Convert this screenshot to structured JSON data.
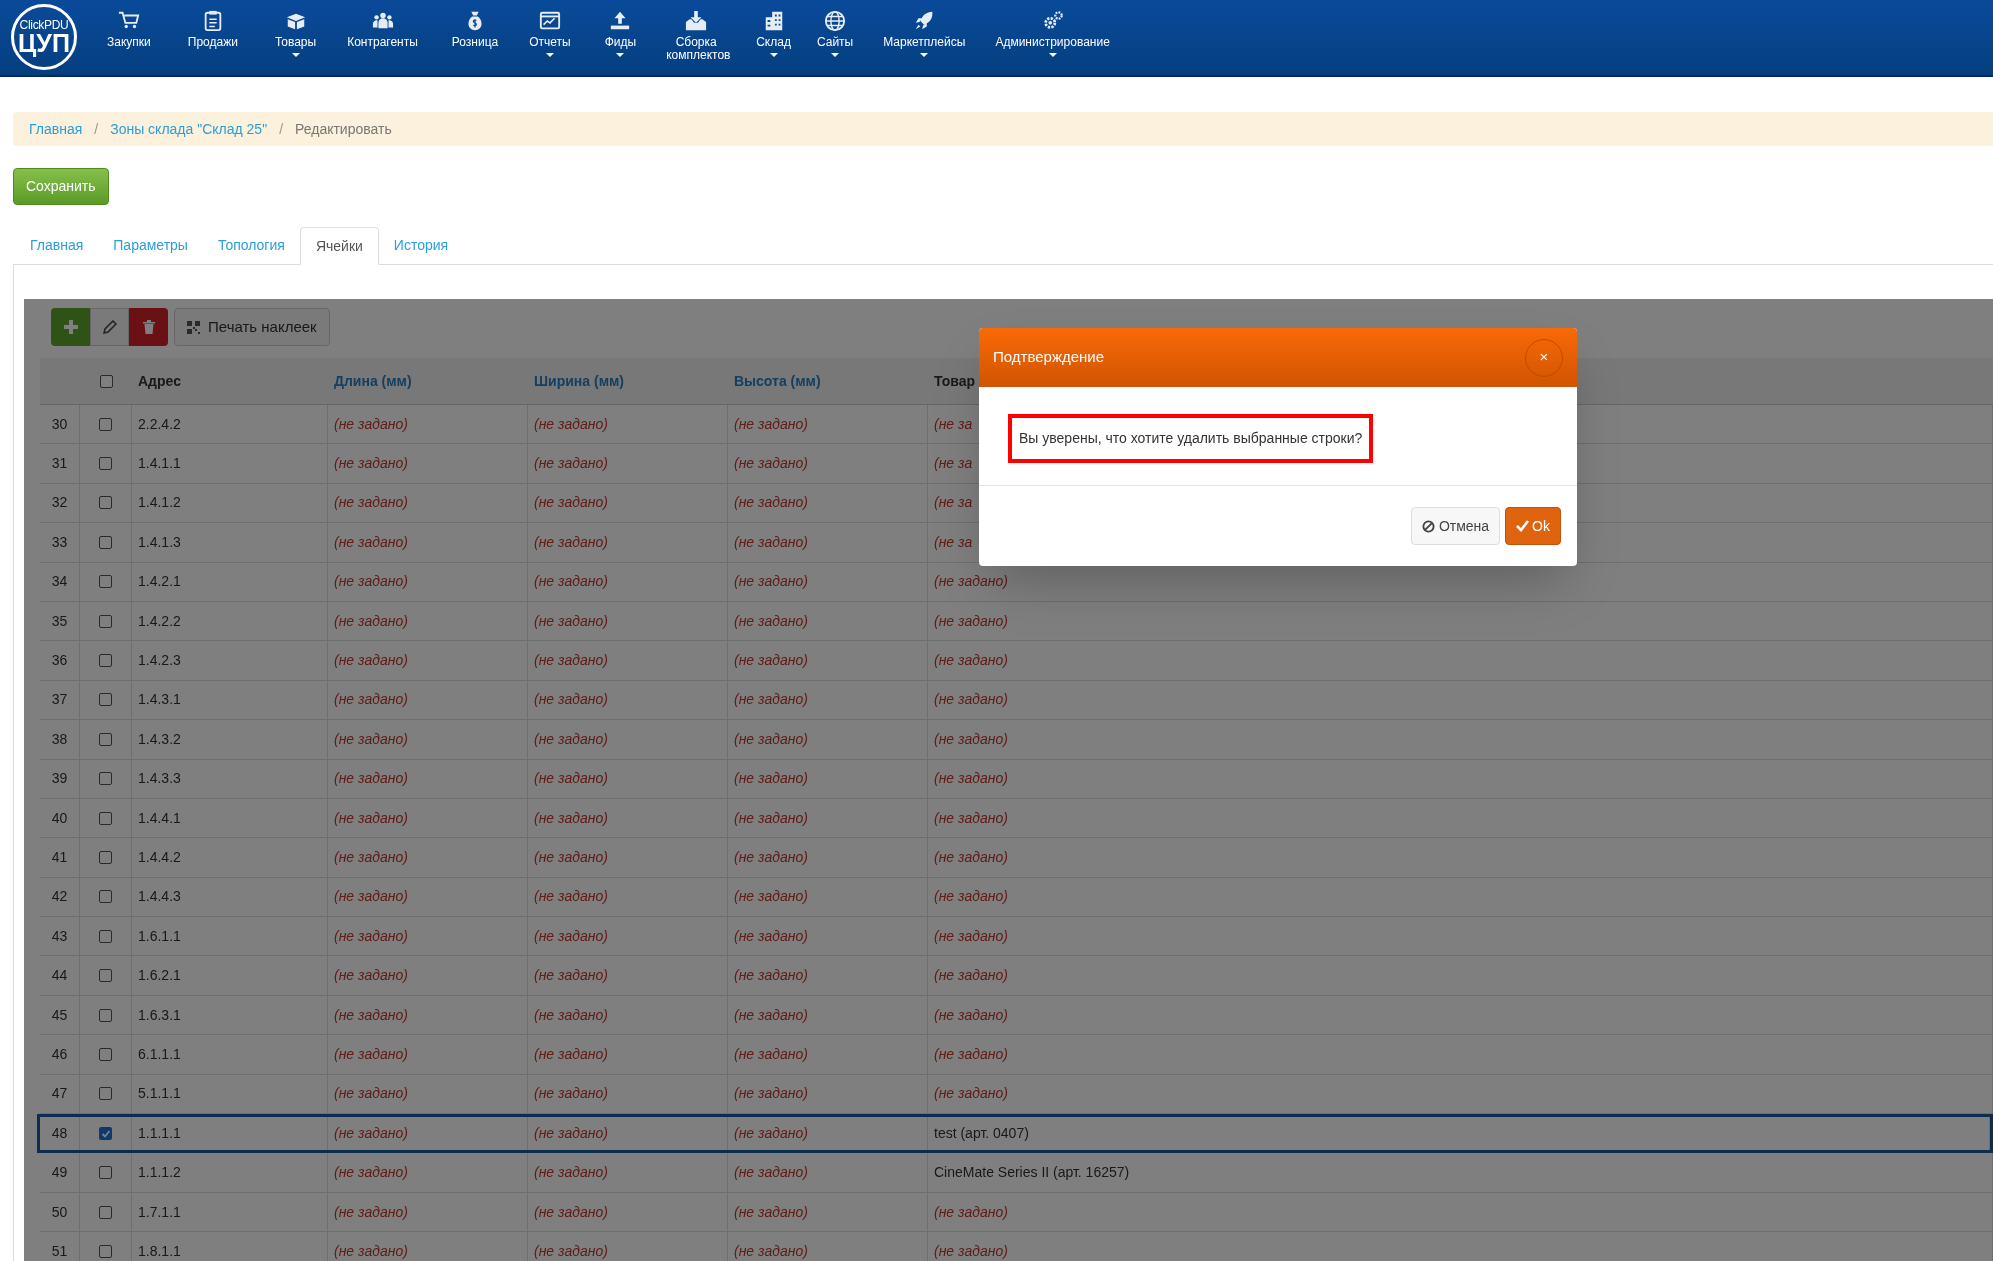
{
  "logo": {
    "line_1": "ClickPDU",
    "line_2": "ЦУП"
  },
  "nav": [
    {
      "label": "Закупки",
      "dropdown": false
    },
    {
      "label": "Продажи",
      "dropdown": false
    },
    {
      "label": "Товары",
      "dropdown": true
    },
    {
      "label": "Контрагенты",
      "dropdown": false
    },
    {
      "label": "Розница",
      "dropdown": false
    },
    {
      "label": "Отчеты",
      "dropdown": true
    },
    {
      "label": "Фиды",
      "dropdown": true
    },
    {
      "label": "Сборка комплектов",
      "dropdown": false
    },
    {
      "label": "Склад",
      "dropdown": true
    },
    {
      "label": "Сайты",
      "dropdown": true
    },
    {
      "label": "Маркетплейсы",
      "dropdown": true
    },
    {
      "label": "Администрирование",
      "dropdown": true
    }
  ],
  "breadcrumb": [
    {
      "label": "Главная",
      "current": false
    },
    {
      "separator": "/",
      "label": "Зоны склада \"Склад 25\"",
      "current": false
    },
    {
      "separator": "/",
      "label": "Редактировать",
      "current": true
    }
  ],
  "save_button": "Сохранить",
  "tabs": [
    {
      "label": "Главная",
      "selected": false
    },
    {
      "label": "Параметры",
      "selected": false
    },
    {
      "label": "Топология",
      "selected": false
    },
    {
      "label": "Ячейки",
      "selected": true
    },
    {
      "label": "История",
      "selected": false
    }
  ],
  "toolbar": {
    "print_button": "Печать наклеек"
  },
  "table": {
    "columns": [
      {
        "label": "Адрес",
        "sortable": false
      },
      {
        "label": "Длина (мм)",
        "sortable": true
      },
      {
        "label": "Ширина (мм)",
        "sortable": true
      },
      {
        "label": "Высота (мм)",
        "sortable": true
      },
      {
        "label": "Товар",
        "sortable": false
      }
    ],
    "header_checked": false,
    "rows": [
      {
        "number": "30",
        "checked": false,
        "cells": [
          {
            "text": "2.2.4.2",
            "unset": false
          },
          {
            "text": "(не задано)",
            "unset": true
          },
          {
            "text": "(не задано)",
            "unset": true
          },
          {
            "text": "(не задано)",
            "unset": true
          },
          {
            "text": "(не за",
            "unset": true
          }
        ]
      },
      {
        "number": "31",
        "checked": false,
        "cells": [
          {
            "text": "1.4.1.1",
            "unset": false
          },
          {
            "text": "(не задано)",
            "unset": true
          },
          {
            "text": "(не задано)",
            "unset": true
          },
          {
            "text": "(не задано)",
            "unset": true
          },
          {
            "text": "(не за",
            "unset": true
          }
        ]
      },
      {
        "number": "32",
        "checked": false,
        "cells": [
          {
            "text": "1.4.1.2",
            "unset": false
          },
          {
            "text": "(не задано)",
            "unset": true
          },
          {
            "text": "(не задано)",
            "unset": true
          },
          {
            "text": "(не задано)",
            "unset": true
          },
          {
            "text": "(не за",
            "unset": true
          }
        ]
      },
      {
        "number": "33",
        "checked": false,
        "cells": [
          {
            "text": "1.4.1.3",
            "unset": false
          },
          {
            "text": "(не задано)",
            "unset": true
          },
          {
            "text": "(не задано)",
            "unset": true
          },
          {
            "text": "(не задано)",
            "unset": true
          },
          {
            "text": "(не за",
            "unset": true
          }
        ]
      },
      {
        "number": "34",
        "checked": false,
        "cells": [
          {
            "text": "1.4.2.1",
            "unset": false
          },
          {
            "text": "(не задано)",
            "unset": true
          },
          {
            "text": "(не задано)",
            "unset": true
          },
          {
            "text": "(не задано)",
            "unset": true
          },
          {
            "text": "(не задано)",
            "unset": true
          }
        ]
      },
      {
        "number": "35",
        "checked": false,
        "cells": [
          {
            "text": "1.4.2.2",
            "unset": false
          },
          {
            "text": "(не задано)",
            "unset": true
          },
          {
            "text": "(не задано)",
            "unset": true
          },
          {
            "text": "(не задано)",
            "unset": true
          },
          {
            "text": "(не задано)",
            "unset": true
          }
        ]
      },
      {
        "number": "36",
        "checked": false,
        "cells": [
          {
            "text": "1.4.2.3",
            "unset": false
          },
          {
            "text": "(не задано)",
            "unset": true
          },
          {
            "text": "(не задано)",
            "unset": true
          },
          {
            "text": "(не задано)",
            "unset": true
          },
          {
            "text": "(не задано)",
            "unset": true
          }
        ]
      },
      {
        "number": "37",
        "checked": false,
        "cells": [
          {
            "text": "1.4.3.1",
            "unset": false
          },
          {
            "text": "(не задано)",
            "unset": true
          },
          {
            "text": "(не задано)",
            "unset": true
          },
          {
            "text": "(не задано)",
            "unset": true
          },
          {
            "text": "(не задано)",
            "unset": true
          }
        ]
      },
      {
        "number": "38",
        "checked": false,
        "cells": [
          {
            "text": "1.4.3.2",
            "unset": false
          },
          {
            "text": "(не задано)",
            "unset": true
          },
          {
            "text": "(не задано)",
            "unset": true
          },
          {
            "text": "(не задано)",
            "unset": true
          },
          {
            "text": "(не задано)",
            "unset": true
          }
        ]
      },
      {
        "number": "39",
        "checked": false,
        "cells": [
          {
            "text": "1.4.3.3",
            "unset": false
          },
          {
            "text": "(не задано)",
            "unset": true
          },
          {
            "text": "(не задано)",
            "unset": true
          },
          {
            "text": "(не задано)",
            "unset": true
          },
          {
            "text": "(не задано)",
            "unset": true
          }
        ]
      },
      {
        "number": "40",
        "checked": false,
        "cells": [
          {
            "text": "1.4.4.1",
            "unset": false
          },
          {
            "text": "(не задано)",
            "unset": true
          },
          {
            "text": "(не задано)",
            "unset": true
          },
          {
            "text": "(не задано)",
            "unset": true
          },
          {
            "text": "(не задано)",
            "unset": true
          }
        ]
      },
      {
        "number": "41",
        "checked": false,
        "cells": [
          {
            "text": "1.4.4.2",
            "unset": false
          },
          {
            "text": "(не задано)",
            "unset": true
          },
          {
            "text": "(не задано)",
            "unset": true
          },
          {
            "text": "(не задано)",
            "unset": true
          },
          {
            "text": "(не задано)",
            "unset": true
          }
        ]
      },
      {
        "number": "42",
        "checked": false,
        "cells": [
          {
            "text": "1.4.4.3",
            "unset": false
          },
          {
            "text": "(не задано)",
            "unset": true
          },
          {
            "text": "(не задано)",
            "unset": true
          },
          {
            "text": "(не задано)",
            "unset": true
          },
          {
            "text": "(не задано)",
            "unset": true
          }
        ]
      },
      {
        "number": "43",
        "checked": false,
        "cells": [
          {
            "text": "1.6.1.1",
            "unset": false
          },
          {
            "text": "(не задано)",
            "unset": true
          },
          {
            "text": "(не задано)",
            "unset": true
          },
          {
            "text": "(не задано)",
            "unset": true
          },
          {
            "text": "(не задано)",
            "unset": true
          }
        ]
      },
      {
        "number": "44",
        "checked": false,
        "cells": [
          {
            "text": "1.6.2.1",
            "unset": false
          },
          {
            "text": "(не задано)",
            "unset": true
          },
          {
            "text": "(не задано)",
            "unset": true
          },
          {
            "text": "(не задано)",
            "unset": true
          },
          {
            "text": "(не задано)",
            "unset": true
          }
        ]
      },
      {
        "number": "45",
        "checked": false,
        "cells": [
          {
            "text": "1.6.3.1",
            "unset": false
          },
          {
            "text": "(не задано)",
            "unset": true
          },
          {
            "text": "(не задано)",
            "unset": true
          },
          {
            "text": "(не задано)",
            "unset": true
          },
          {
            "text": "(не задано)",
            "unset": true
          }
        ]
      },
      {
        "number": "46",
        "checked": false,
        "cells": [
          {
            "text": "6.1.1.1",
            "unset": false
          },
          {
            "text": "(не задано)",
            "unset": true
          },
          {
            "text": "(не задано)",
            "unset": true
          },
          {
            "text": "(не задано)",
            "unset": true
          },
          {
            "text": "(не задано)",
            "unset": true
          }
        ]
      },
      {
        "number": "47",
        "checked": false,
        "cells": [
          {
            "text": "5.1.1.1",
            "unset": false
          },
          {
            "text": "(не задано)",
            "unset": true
          },
          {
            "text": "(не задано)",
            "unset": true
          },
          {
            "text": "(не задано)",
            "unset": true
          },
          {
            "text": "(не задано)",
            "unset": true
          }
        ]
      },
      {
        "number": "48",
        "checked": true,
        "cells": [
          {
            "text": "1.1.1.1",
            "unset": false
          },
          {
            "text": "(не задано)",
            "unset": true
          },
          {
            "text": "(не задано)",
            "unset": true
          },
          {
            "text": "(не задано)",
            "unset": true
          },
          {
            "text": "test (арт. 0407)",
            "unset": false
          }
        ]
      },
      {
        "number": "49",
        "checked": false,
        "cells": [
          {
            "text": "1.1.1.2",
            "unset": false
          },
          {
            "text": "(не задано)",
            "unset": true
          },
          {
            "text": "(не задано)",
            "unset": true
          },
          {
            "text": "(не задано)",
            "unset": true
          },
          {
            "text": "CineMate Series II (арт. 16257)",
            "unset": false
          }
        ]
      },
      {
        "number": "50",
        "checked": false,
        "cells": [
          {
            "text": "1.7.1.1",
            "unset": false
          },
          {
            "text": "(не задано)",
            "unset": true
          },
          {
            "text": "(не задано)",
            "unset": true
          },
          {
            "text": "(не задано)",
            "unset": true
          },
          {
            "text": "(не задано)",
            "unset": true
          }
        ]
      },
      {
        "number": "51",
        "checked": false,
        "cells": [
          {
            "text": "1.8.1.1",
            "unset": false
          },
          {
            "text": "(не задано)",
            "unset": true
          },
          {
            "text": "(не задано)",
            "unset": true
          },
          {
            "text": "(не задано)",
            "unset": true
          },
          {
            "text": "(не задано)",
            "unset": true
          }
        ]
      }
    ]
  },
  "dialog": {
    "title": "Подтверждение",
    "close": "×",
    "message": "Вы уверены, что хотите удалить выбранные строки?",
    "buttons": [
      {
        "label": "Отмена",
        "kind": "cancel"
      },
      {
        "label": "Ok",
        "kind": "ok"
      }
    ]
  }
}
